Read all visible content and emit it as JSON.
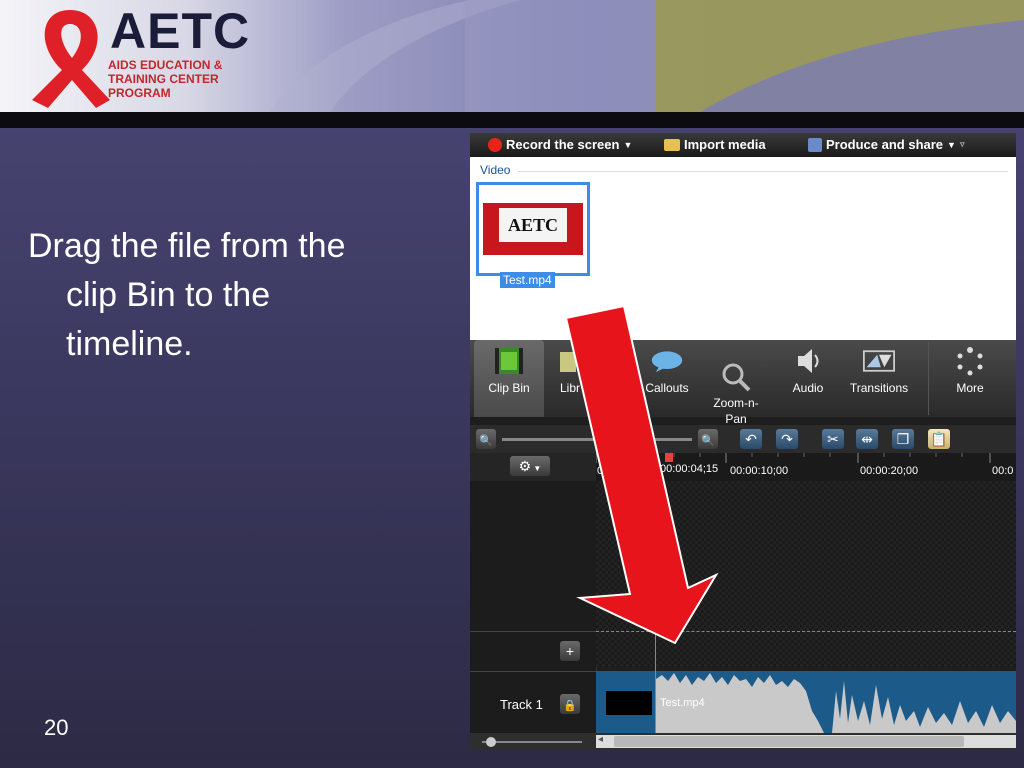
{
  "banner": {
    "logo_title": "AETC",
    "logo_line1": "AIDS EDUCATION &",
    "logo_line2": "TRAINING CENTER",
    "logo_line3": "PROGRAM"
  },
  "slide": {
    "line1": "Drag the file from the",
    "line2": "clip Bin to the",
    "line3": "timeline.",
    "page_number": "20"
  },
  "app": {
    "toolbar": {
      "record_label": "Record the screen",
      "import_label": "Import media",
      "produce_label": "Produce and share"
    },
    "bin": {
      "section_label": "Video",
      "thumb_text": "AETC",
      "file_name": "Test.mp4"
    },
    "tabs": [
      {
        "label": "Clip Bin"
      },
      {
        "label": "Libr"
      },
      {
        "label": "Callouts"
      },
      {
        "label": "Zoom-n-\nPan"
      },
      {
        "label": "Audio"
      },
      {
        "label": "Transitions"
      },
      {
        "label": "More"
      }
    ],
    "timeline": {
      "current_time": "00:00:04;15",
      "start_time_partial": "0",
      "tick_10": "00:00:10;00",
      "tick_20": "00:00:20;00",
      "tick_30_partial": "00:0"
    },
    "track": {
      "name": "Track 1",
      "clip_name": "Test.mp4"
    }
  },
  "colors": {
    "accent_blue": "#3d8ce8",
    "arrow_red": "#e8141b",
    "waveform": "#c9c9c9"
  }
}
